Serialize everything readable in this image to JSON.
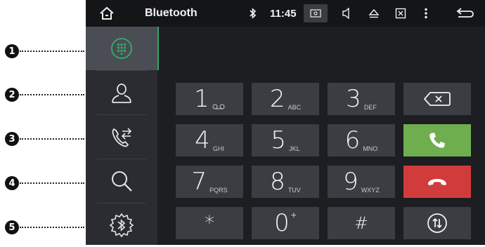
{
  "callouts": [
    "1",
    "2",
    "3",
    "4",
    "5"
  ],
  "status_bar": {
    "title": "Bluetooth",
    "time": "11:45",
    "icons": [
      "home-icon",
      "bluetooth-icon",
      "screenshot-icon",
      "volume-icon",
      "eject-icon",
      "close-app-icon",
      "more-vert-icon",
      "back-icon"
    ]
  },
  "sidebar": {
    "items": [
      {
        "name": "dialpad",
        "icon": "dialpad-icon",
        "active": true
      },
      {
        "name": "contacts",
        "icon": "person-icon",
        "active": false
      },
      {
        "name": "call-log",
        "icon": "phone-transfer-icon",
        "active": false
      },
      {
        "name": "search",
        "icon": "search-icon",
        "active": false
      },
      {
        "name": "bluetooth-settings",
        "icon": "bluetooth-gear-icon",
        "active": false
      }
    ]
  },
  "keypad": {
    "k1": {
      "digit": "1",
      "letters": ""
    },
    "k2": {
      "digit": "2",
      "letters": "ABC"
    },
    "k3": {
      "digit": "3",
      "letters": "DEF"
    },
    "k4": {
      "digit": "4",
      "letters": "GHI"
    },
    "k5": {
      "digit": "5",
      "letters": "JKL"
    },
    "k6": {
      "digit": "6",
      "letters": "MNO"
    },
    "k7": {
      "digit": "7",
      "letters": "PQRS"
    },
    "k8": {
      "digit": "8",
      "letters": "TUV"
    },
    "k9": {
      "digit": "9",
      "letters": "WXYZ"
    },
    "star": {
      "digit": "*"
    },
    "k0": {
      "digit": "0",
      "letters": "+"
    },
    "hash": {
      "digit": "#"
    }
  },
  "colors": {
    "accent": "#37a56b",
    "call": "#6fae4f",
    "hangup": "#d23b3b",
    "key_bg": "#3a3d42",
    "background": "#1c1e22"
  }
}
